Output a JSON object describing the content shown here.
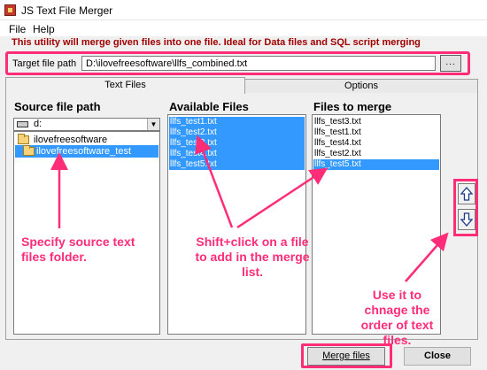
{
  "window": {
    "title": "JS Text File Merger"
  },
  "menu": [
    "File",
    "Help"
  ],
  "notice": "This utility will merge given files into one file.  Ideal for Data files and SQL script merging",
  "target": {
    "label": "Target file path",
    "value": "D:\\ilovefreesoftware\\llfs_combined.txt",
    "browse_label": "..."
  },
  "tabs": [
    {
      "label": "Text Files",
      "active": true
    },
    {
      "label": "Options",
      "active": false
    }
  ],
  "source": {
    "header": "Source file path",
    "drive": "d:",
    "folders": [
      {
        "name": "ilovefreesoftware",
        "selected": false
      },
      {
        "name": "ilovefreesoftware_test",
        "selected": true
      }
    ]
  },
  "available": {
    "header": "Available Files",
    "files": [
      "llfs_test1.txt",
      "llfs_test2.txt",
      "llfs_test3.txt",
      "llfs_test4.txt",
      "llfs_test5.txt"
    ]
  },
  "merge": {
    "header": "Files to merge",
    "files": [
      "llfs_test3.txt",
      "llfs_test1.txt",
      "llfs_test4.txt",
      "llfs_test2.txt",
      "llfs_test5.txt"
    ],
    "selected_index": 4
  },
  "order_buttons": {
    "up_icon": "up-arrow-icon",
    "down_icon": "down-arrow-icon"
  },
  "buttons": {
    "merge": "Merge files",
    "close": "Close"
  },
  "annotations": {
    "source": "Specify source text files folder.",
    "available": "Shift+click on a file to add in the merge list.",
    "order": "Use it to chnage the order of text files."
  },
  "colors": {
    "annotation": "#ff2d78",
    "notice": "#a00000",
    "selection": "#3399ff"
  }
}
